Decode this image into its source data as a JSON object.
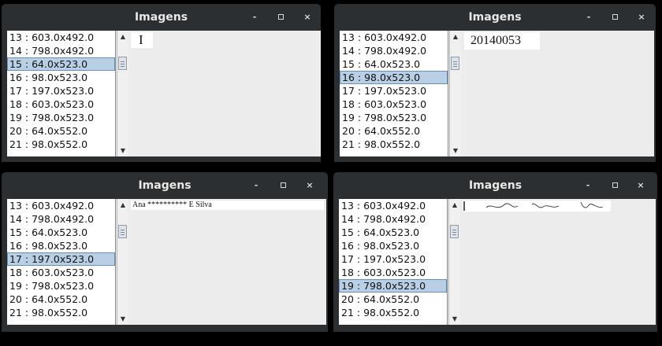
{
  "window_title": "Imagens",
  "titlebar_buttons": {
    "minimize": "-",
    "close": "×"
  },
  "list_items": [
    "13 : 603.0x492.0",
    "14 : 798.0x492.0",
    "15 : 64.0x523.0",
    "16 : 98.0x523.0",
    "17 : 197.0x523.0",
    "18 : 603.0x523.0",
    "19 : 798.0x523.0",
    "20 : 64.0x552.0",
    "21 : 98.0x552.0"
  ],
  "windows": [
    {
      "selected": "15 : 64.0x523.0",
      "preview_text": "I"
    },
    {
      "selected": "16 : 98.0x523.0",
      "preview_text": "20140053"
    },
    {
      "selected": "17 : 197.0x523.0",
      "preview_text": "Ana ********** E Silva"
    },
    {
      "selected": "19 : 798.0x523.0",
      "preview_text": ""
    }
  ],
  "icons": {
    "minimize": "minimize-icon",
    "maximize": "maximize-icon",
    "close": "close-icon",
    "scroll_up": "arrow-up-icon",
    "scroll_down": "arrow-down-icon"
  }
}
